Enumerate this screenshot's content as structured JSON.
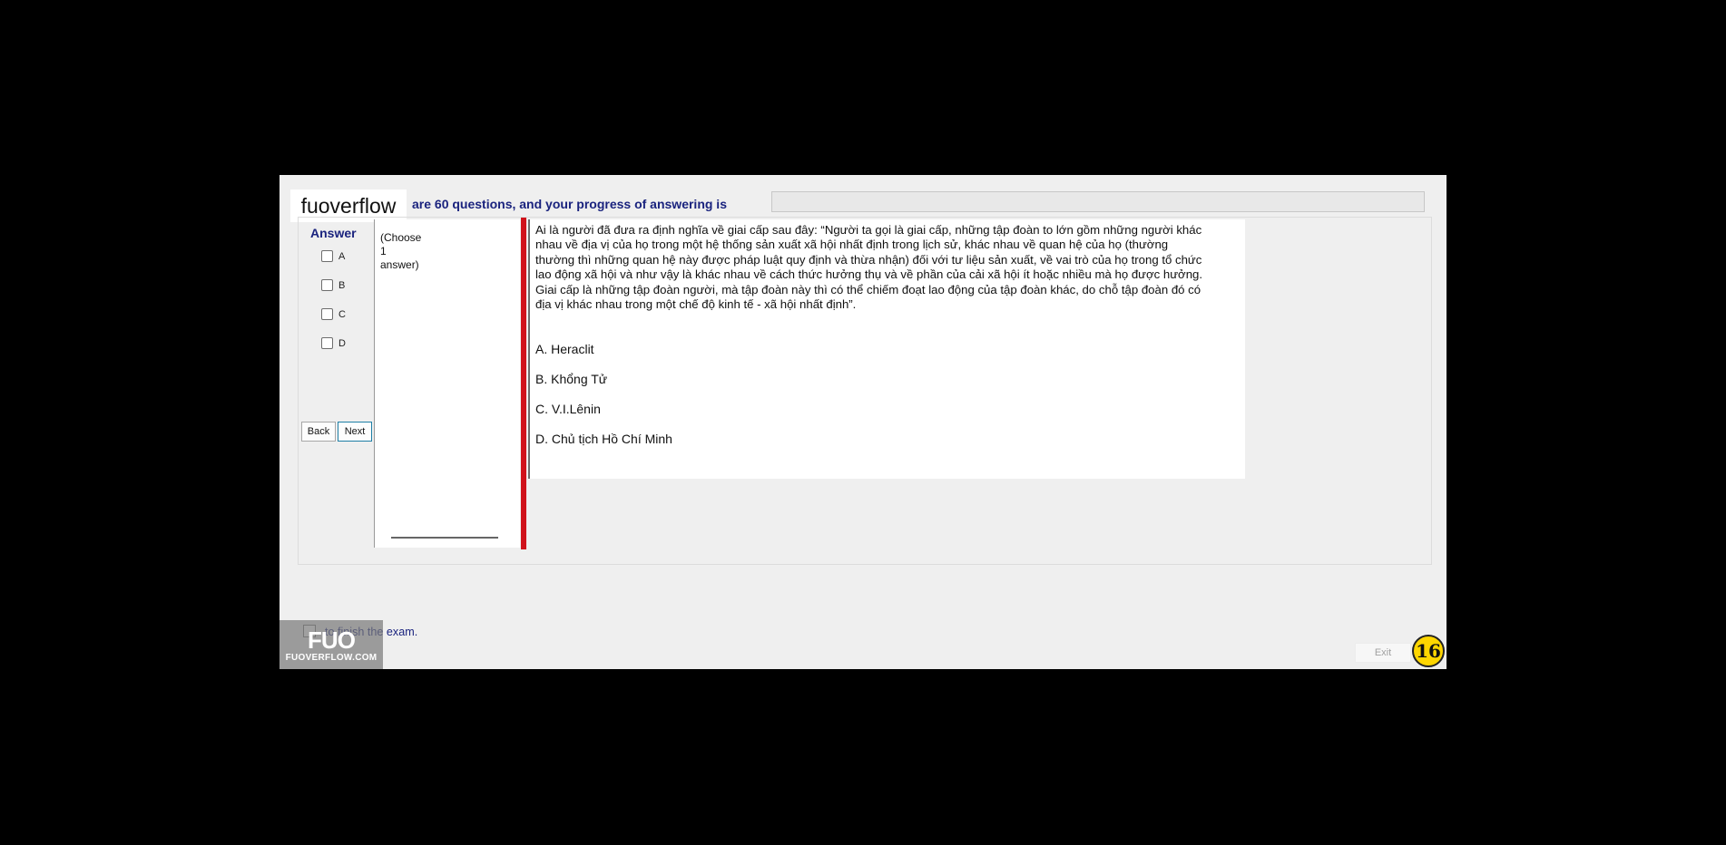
{
  "header": {
    "watermark_label": "fuoverflow",
    "progress_text": "are 60 questions, and your progress of answering is"
  },
  "progress": {
    "fraction": 0
  },
  "answer_panel": {
    "heading": "Answer",
    "options": [
      "A",
      "B",
      "C",
      "D"
    ],
    "back_label": "Back",
    "next_label": "Next"
  },
  "instruction": {
    "lines": [
      "(Choose",
      "1",
      "answer)"
    ]
  },
  "question": {
    "text": "Ai là người đã đưa ra định nghĩa về giai cấp sau đây: “Người ta gọi là giai cấp, những tập đoàn to lớn gồm những người khác nhau về địa vị của họ trong một hệ thống sản xuất xã hội nhất định trong lịch sử, khác nhau về quan hệ của họ (thường thường thì những quan hệ này được pháp luật quy định và thừa nhận) đối với tư liệu sản xuất, về vai trò của họ trong tổ chức lao động xã hội và như vậy là khác nhau về cách thức hưởng thụ và về phần của cải xã hội ít hoặc nhiều mà họ được hưởng. Giai cấp là những tập đoàn người, mà tập đoàn này thì có thể chiếm đoạt lao động của tập đoàn khác, do chỗ tập đoàn đó có địa vị khác nhau trong một chế độ kinh tế - xã hội nhất định”.",
    "answers": [
      "A.  Heraclit",
      "B.  Khổng Tử",
      "C.  V.I.Lênin",
      "D.  Chủ tịch Hồ Chí Minh"
    ]
  },
  "footer": {
    "finish_text": "to finish the exam.",
    "logo_big": "FUO",
    "logo_small": "FUOVERFLOW.COM",
    "exit_label": "Exit",
    "page_number": "16"
  }
}
